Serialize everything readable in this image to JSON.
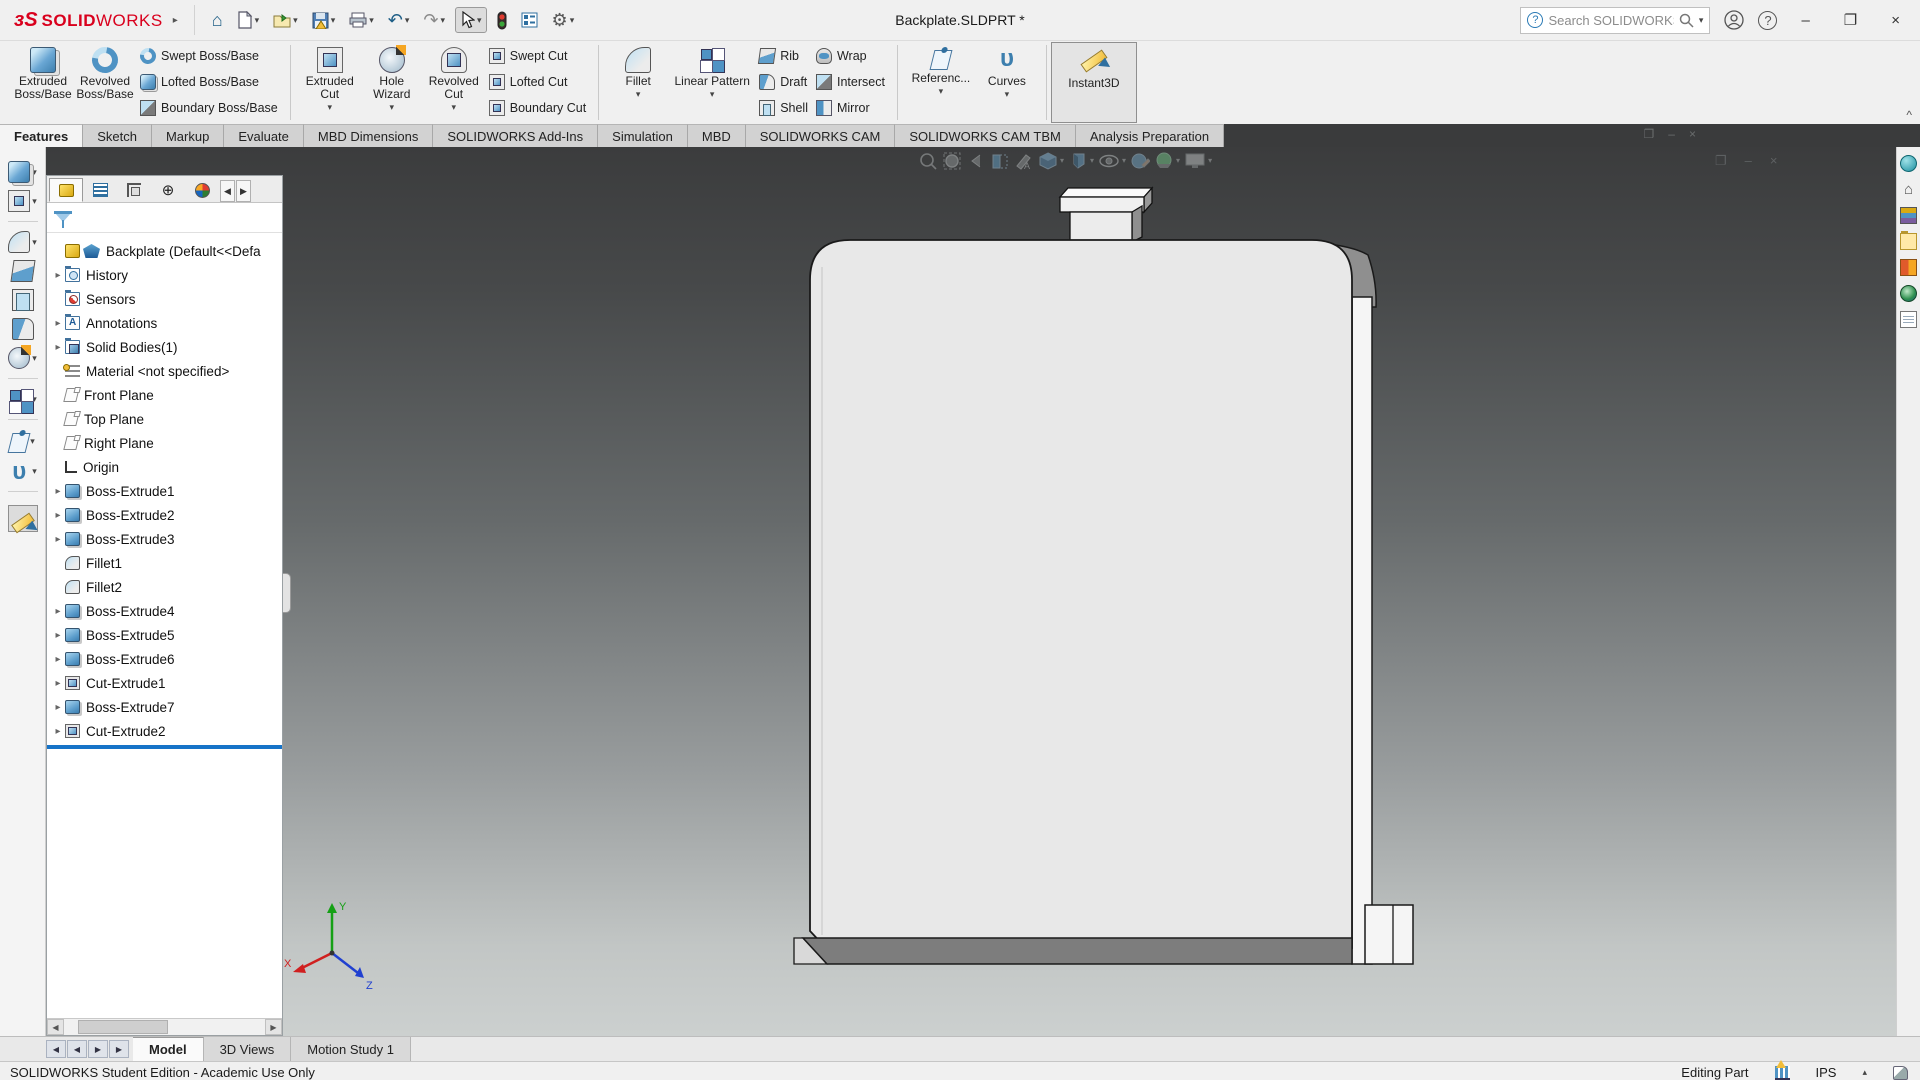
{
  "titlebar": {
    "app_bold": "SOLID",
    "app_light": "WORKS",
    "logo_mark": "ɜS",
    "doc_title": "Backplate.SLDPRT *",
    "search_placeholder": "Search SOLIDWORKS Help"
  },
  "icons": {
    "dropdown": "▾",
    "caret_right": "▸",
    "home": "⌂",
    "gear": "⚙",
    "undo": "↶",
    "redo": "↷",
    "list": "▤",
    "question": "?",
    "help": "?",
    "minimize": "–",
    "close": "×",
    "chevron_up": "^",
    "dimxpert": "⊕",
    "curves_glyph": "υ",
    "nav_first": "◀",
    "nav_prev": "◀",
    "nav_next": "▶",
    "nav_last": "▶",
    "left_arrow": "◀",
    "right_arrow": "▶",
    "units_caret": "▴",
    "win_restore": "❐",
    "eye": "◉",
    "orientation_cube": "▣",
    "display_style": "◫",
    "zoom_fit": "◎",
    "zoom_area": "◌",
    "prev_view": "◄",
    "section": "◧",
    "anno_vis": "✎",
    "appearance": "●",
    "scene": "●",
    "view_settings": "▭"
  },
  "ribbon": {
    "extruded_boss": "Extruded Boss/Base",
    "revolved_boss": "Revolved Boss/Base",
    "swept_boss": "Swept Boss/Base",
    "lofted_boss": "Lofted Boss/Base",
    "boundary_boss": "Boundary Boss/Base",
    "extruded_cut": "Extruded Cut",
    "hole_wizard": "Hole Wizard",
    "revolved_cut": "Revolved Cut",
    "swept_cut": "Swept Cut",
    "lofted_cut": "Lofted Cut",
    "boundary_cut": "Boundary Cut",
    "fillet": "Fillet",
    "linear_pattern": "Linear Pattern",
    "rib": "Rib",
    "draft": "Draft",
    "shell": "Shell",
    "wrap": "Wrap",
    "intersect": "Intersect",
    "mirror": "Mirror",
    "reference": "Referenc...",
    "curves": "Curves",
    "instant3d": "Instant3D"
  },
  "command_tabs": [
    "Features",
    "Sketch",
    "Markup",
    "Evaluate",
    "MBD Dimensions",
    "SOLIDWORKS Add-Ins",
    "Simulation",
    "MBD",
    "SOLIDWORKS CAM",
    "SOLIDWORKS CAM TBM",
    "Analysis Preparation"
  ],
  "tree": {
    "root": "Backplate  (Default<<Defa",
    "items": [
      "History",
      "Sensors",
      "Annotations",
      "Solid Bodies(1)",
      "Material <not specified>",
      "Front Plane",
      "Top Plane",
      "Right Plane",
      "Origin",
      "Boss-Extrude1",
      "Boss-Extrude2",
      "Boss-Extrude3",
      "Fillet1",
      "Fillet2",
      "Boss-Extrude4",
      "Boss-Extrude5",
      "Boss-Extrude6",
      "Cut-Extrude1",
      "Boss-Extrude7",
      "Cut-Extrude2"
    ]
  },
  "viewport": {
    "triad": {
      "x": "X",
      "y": "Y",
      "z": "Z"
    }
  },
  "bottom": {
    "model": "Model",
    "views_3d": "3D Views",
    "motion": "Motion Study 1"
  },
  "status": {
    "left": "SOLIDWORKS Student Edition - Academic Use Only",
    "editing": "Editing Part",
    "units": "IPS"
  },
  "colors": {
    "brand_red": "#d9001d",
    "rollback_blue": "#1673c8",
    "part_face": "#e8e8e8",
    "viewport_top": "#3b3c3d",
    "viewport_bottom": "#ccd0cf"
  }
}
